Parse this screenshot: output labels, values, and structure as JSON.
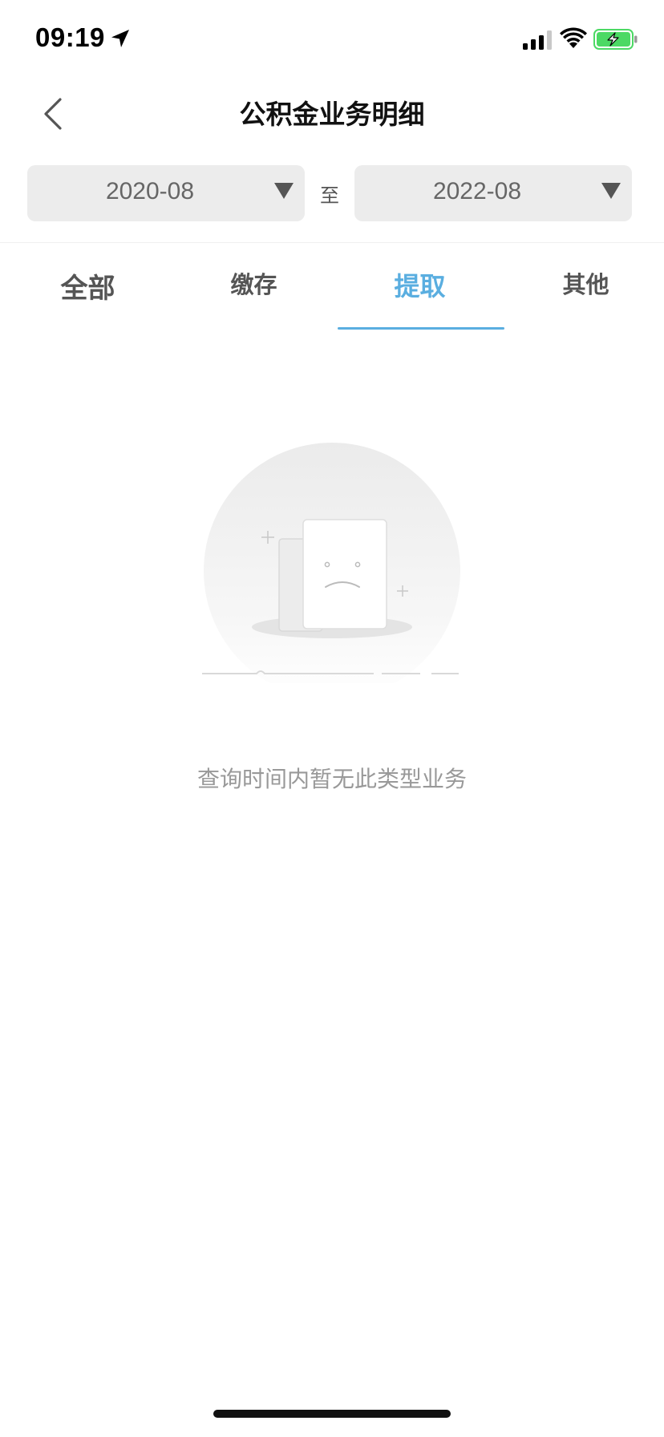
{
  "status_bar": {
    "time": "09:19",
    "icons": [
      "location-arrow-icon",
      "cellular-signal-icon",
      "wifi-icon",
      "battery-charging-icon"
    ],
    "battery_color": "#4cd964"
  },
  "header": {
    "back_icon": "chevron-left-icon",
    "title": "公积金业务明细"
  },
  "date_range": {
    "start": "2020-08",
    "separator": "至",
    "end": "2022-08"
  },
  "tabs": [
    {
      "label": "全部",
      "active": false
    },
    {
      "label": "缴存",
      "active": false
    },
    {
      "label": "提取",
      "active": true
    },
    {
      "label": "其他",
      "active": false
    }
  ],
  "empty_state": {
    "illustration": "empty-document-sad-face-icon",
    "message": "查询时间内暂无此类型业务"
  },
  "colors": {
    "accent": "#5aaee0",
    "select_bg": "#ececec",
    "muted_text": "#999999"
  }
}
